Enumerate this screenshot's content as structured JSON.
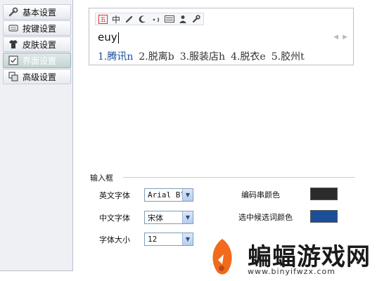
{
  "sidebar": {
    "items": [
      {
        "label": "基本设置",
        "icon": "wrench-icon"
      },
      {
        "label": "按键设置",
        "icon": "keyboard-icon"
      },
      {
        "label": "皮肤设置",
        "icon": "shirt-icon"
      },
      {
        "label": "界面设置",
        "icon": "checkbox-icon",
        "active": true
      },
      {
        "label": "高级设置",
        "icon": "copy-icon"
      }
    ]
  },
  "preview": {
    "toolbar": [
      "中"
    ],
    "composition": "euy",
    "candidates": [
      "1.腾讯n",
      "2.脱离b",
      "3.服装店h",
      "4.脱衣e",
      "5.胶州t"
    ]
  },
  "input_frame": {
    "section_title": "输入框",
    "english_font_label": "英文字体",
    "english_font_value": "Arial Bl",
    "chinese_font_label": "中文字体",
    "chinese_font_value": "宋体",
    "font_size_label": "字体大小",
    "font_size_value": "12",
    "code_string_color_label": "编码串颜色",
    "code_string_color": "#2b2b2b",
    "selected_candidate_color_label": "选中候选词颜色",
    "selected_candidate_color": "#1c4f9a"
  },
  "watermark": {
    "brand": "蝙蝠游戏网",
    "url": "www.binyifwzx.com"
  }
}
